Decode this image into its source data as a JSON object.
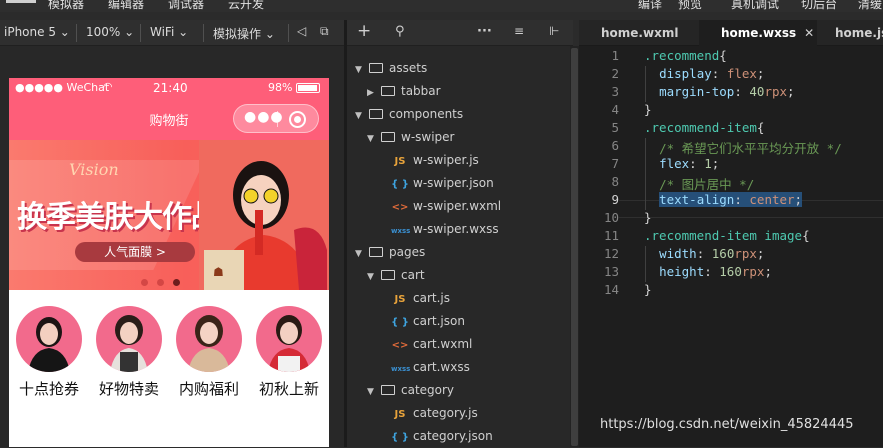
{
  "menubar": {
    "items_left": [
      "模拟器",
      "编辑器",
      "调试器",
      "云开发"
    ],
    "items_right": [
      "编译",
      "预览",
      "真机调试",
      "切后台",
      "清缓"
    ]
  },
  "simulator_toolbar": {
    "device": "iPhone 5",
    "zoom": "100%",
    "network": "WiFi",
    "simulate_ops": "模拟操作",
    "volume_icon": "speaker-icon",
    "window_icon": "detach-window-icon"
  },
  "phone": {
    "status": {
      "signal": "●●●●● WeChat",
      "time": "21:40",
      "battery": "98%"
    },
    "nav_title": "购物街",
    "banner": {
      "headline": "换季美肤大作战",
      "script_text": "Vision",
      "pill": "人气面膜 >"
    },
    "recommend": [
      {
        "label": "十点抢券"
      },
      {
        "label": "好物特卖"
      },
      {
        "label": "内购福利"
      },
      {
        "label": "初秋上新"
      }
    ]
  },
  "file_tree": {
    "toolbar_icons": [
      "add-icon",
      "search-icon",
      "more-icon",
      "collapse-icon",
      "split-icon"
    ],
    "nodes": [
      {
        "label": "assets",
        "type": "folder",
        "open": true,
        "depth": 0
      },
      {
        "label": "tabbar",
        "type": "folder",
        "open": false,
        "depth": 1
      },
      {
        "label": "components",
        "type": "folder",
        "open": true,
        "depth": 0
      },
      {
        "label": "w-swiper",
        "type": "folder",
        "open": true,
        "depth": 1
      },
      {
        "label": "w-swiper.js",
        "type": "js",
        "depth": 2
      },
      {
        "label": "w-swiper.json",
        "type": "json",
        "depth": 2
      },
      {
        "label": "w-swiper.wxml",
        "type": "wxml",
        "depth": 2
      },
      {
        "label": "w-swiper.wxss",
        "type": "wxss",
        "depth": 2
      },
      {
        "label": "pages",
        "type": "folder",
        "open": true,
        "depth": 0
      },
      {
        "label": "cart",
        "type": "folder",
        "open": true,
        "depth": 1
      },
      {
        "label": "cart.js",
        "type": "js",
        "depth": 2
      },
      {
        "label": "cart.json",
        "type": "json",
        "depth": 2
      },
      {
        "label": "cart.wxml",
        "type": "wxml",
        "depth": 2
      },
      {
        "label": "cart.wxss",
        "type": "wxss",
        "depth": 2
      },
      {
        "label": "category",
        "type": "folder",
        "open": true,
        "depth": 1
      },
      {
        "label": "category.js",
        "type": "js",
        "depth": 2
      },
      {
        "label": "category.json",
        "type": "json",
        "depth": 2
      }
    ],
    "file_icons": {
      "js": "JS",
      "json": "{ }",
      "wxml": "<>",
      "wxss": "wxss"
    }
  },
  "editor": {
    "tabs": [
      {
        "label": "home.wxml",
        "active": false
      },
      {
        "label": "home.wxss",
        "active": true,
        "close": "✕"
      },
      {
        "label": "home.js",
        "active": false
      }
    ],
    "current_line": 9,
    "lines": [
      ".recommend{",
      "  display: flex;",
      "  margin-top: 40rpx;",
      "}",
      ".recommend-item{",
      "  /* 希望它们水平平均分开放 */",
      "  flex: 1;",
      "  /* 图片居中 */",
      "  text-align: center;",
      "}",
      ".recommend-item image{",
      "  width: 160rpx;",
      "  height: 160rpx;",
      "}"
    ]
  },
  "watermark": "https://blog.csdn.net/weixin_45824445",
  "colors": {
    "theme_pink": "#fe5e79",
    "editor_bg": "#1e1e1e",
    "selection": "#264f78"
  }
}
